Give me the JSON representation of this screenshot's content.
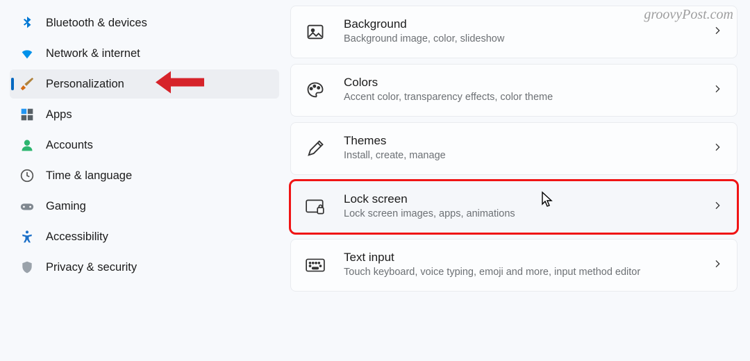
{
  "watermark": "groovyPost.com",
  "sidebar": {
    "items": [
      {
        "label": "Bluetooth & devices",
        "icon": "bluetooth"
      },
      {
        "label": "Network & internet",
        "icon": "wifi"
      },
      {
        "label": "Personalization",
        "icon": "brush",
        "selected": true,
        "arrow": true
      },
      {
        "label": "Apps",
        "icon": "apps"
      },
      {
        "label": "Accounts",
        "icon": "account"
      },
      {
        "label": "Time & language",
        "icon": "clock"
      },
      {
        "label": "Gaming",
        "icon": "gamepad"
      },
      {
        "label": "Accessibility",
        "icon": "accessibility"
      },
      {
        "label": "Privacy & security",
        "icon": "shield"
      }
    ]
  },
  "main": {
    "cards": [
      {
        "title": "Background",
        "sub": "Background image, color, slideshow",
        "icon": "image"
      },
      {
        "title": "Colors",
        "sub": "Accent color, transparency effects, color theme",
        "icon": "palette"
      },
      {
        "title": "Themes",
        "sub": "Install, create, manage",
        "icon": "pen"
      },
      {
        "title": "Lock screen",
        "sub": "Lock screen images, apps, animations",
        "icon": "lock-screen",
        "highlighted": true,
        "cursor": true
      },
      {
        "title": "Text input",
        "sub": "Touch keyboard, voice typing, emoji and more, input method editor",
        "icon": "keyboard"
      }
    ]
  }
}
